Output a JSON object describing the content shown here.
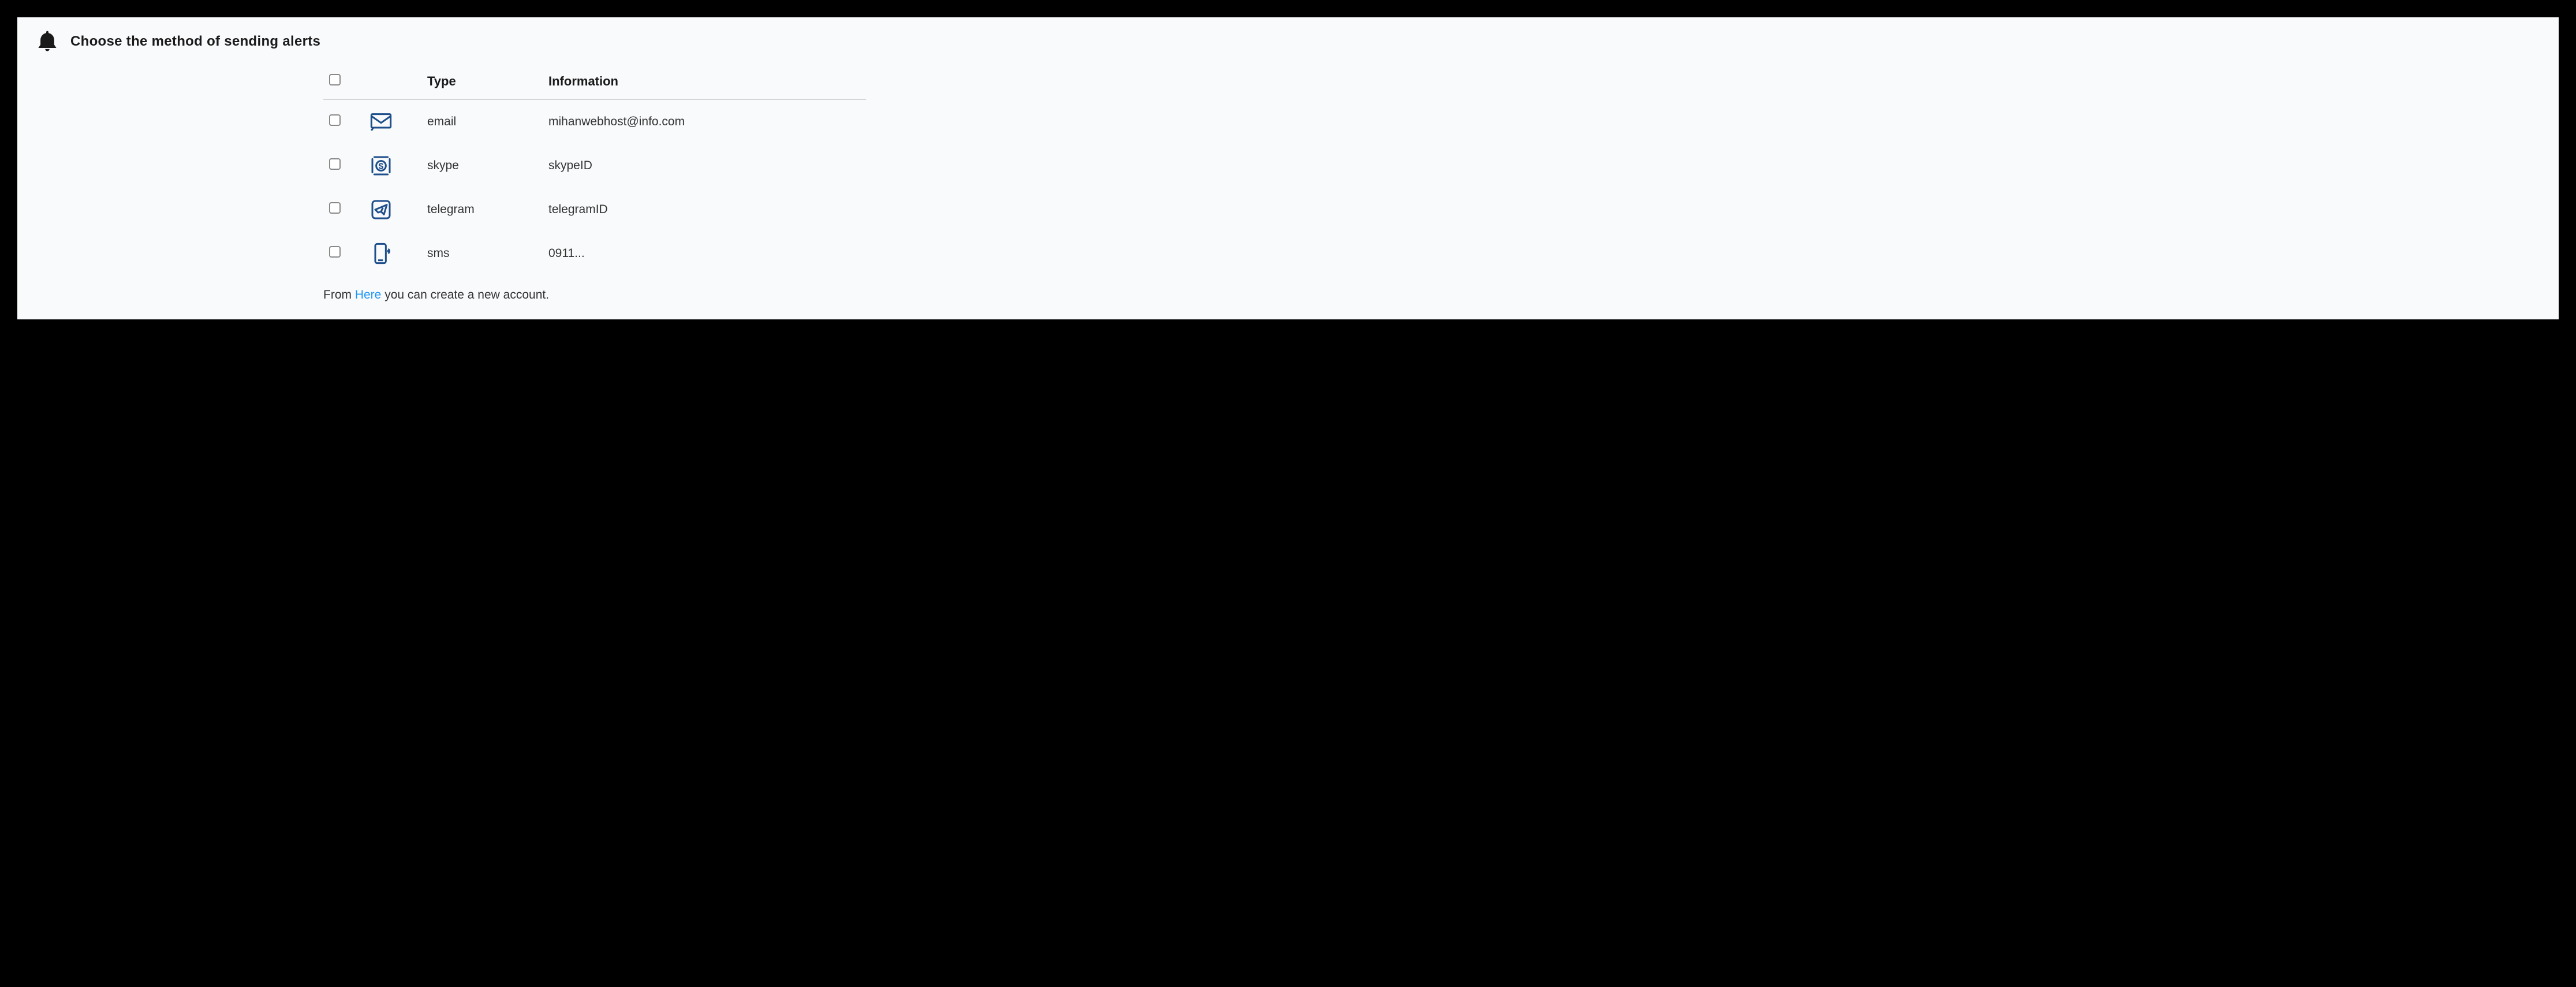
{
  "header": {
    "title": "Choose the method of sending alerts"
  },
  "table": {
    "columns": {
      "type": "Type",
      "info": "Information"
    },
    "rows": [
      {
        "icon": "email-icon",
        "type": "email",
        "info": "mihanwebhost@info.com"
      },
      {
        "icon": "skype-icon",
        "type": "skype",
        "info": "skypeID"
      },
      {
        "icon": "telegram-icon",
        "type": "telegram",
        "info": "telegramID"
      },
      {
        "icon": "sms-icon",
        "type": "sms",
        "info": "0911..."
      }
    ]
  },
  "footer": {
    "prefix": "From ",
    "link": "Here",
    "suffix": " you can create a new account."
  }
}
